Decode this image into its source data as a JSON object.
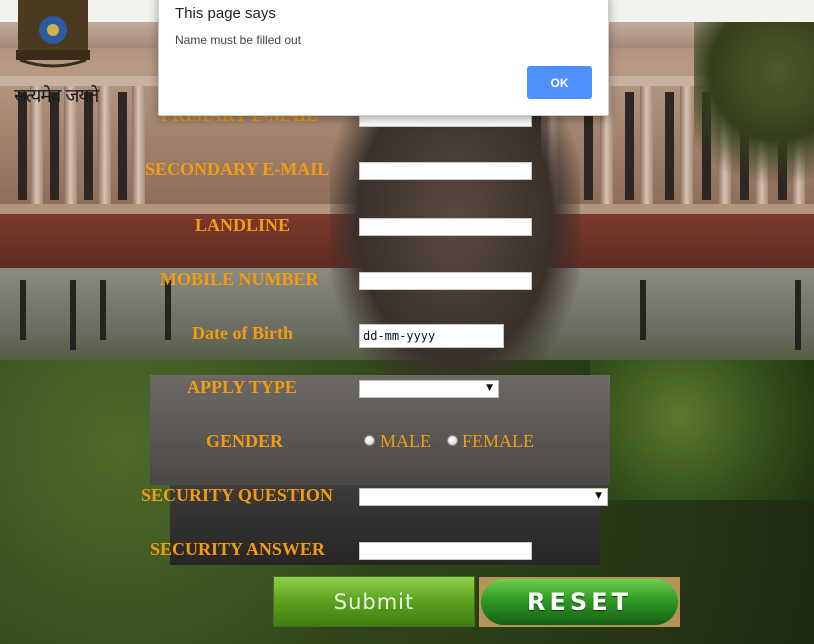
{
  "emblem": {
    "motto": "सत्यमेव जयते",
    "icon": "national-emblem-icon"
  },
  "form": {
    "primary_email_label": "PRIMARY E-MAIL",
    "secondary_email_label": "SECONDARY E-MAIL",
    "landline_label": "LANDLINE",
    "mobile_label": "MOBILE NUMBER",
    "dob_label": "Date of Birth",
    "dob_placeholder": "dd-mm-yyyy",
    "apply_type_label": "APPLY TYPE",
    "gender_label": "GENDER",
    "gender_options": [
      "MALE",
      "FEMALE"
    ],
    "security_question_label": "SECURITY QUESTION",
    "security_answer_label": "SECURITY ANSWER",
    "submit_label": "Submit",
    "reset_label": "RESET"
  },
  "dialog": {
    "title": "This page says",
    "message": "Name must be filled out",
    "ok_label": "OK"
  },
  "colors": {
    "label": "#f39c12",
    "ok_button": "#4d90fe"
  }
}
